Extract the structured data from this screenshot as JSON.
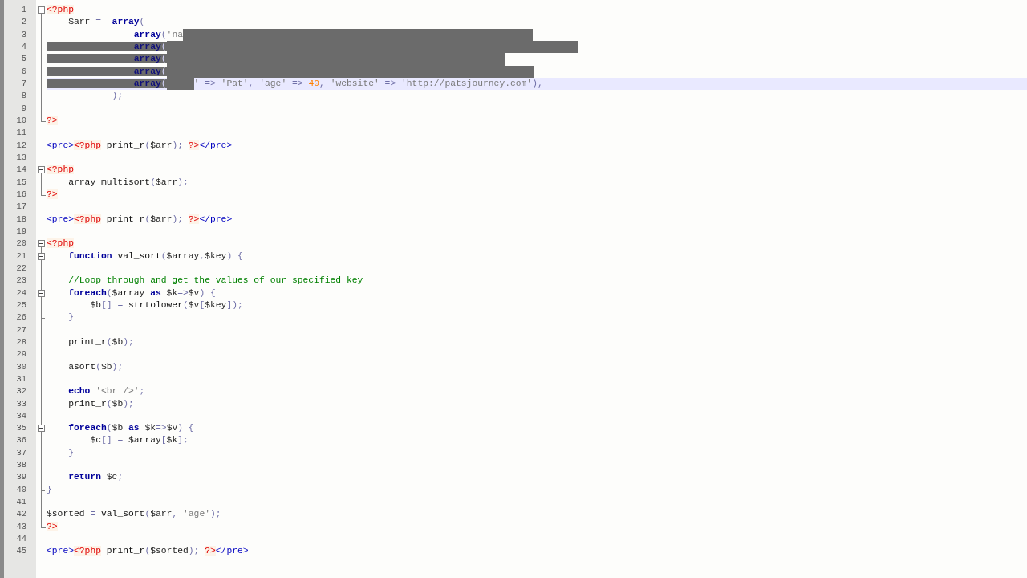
{
  "editor": {
    "lines": [
      {
        "number": "1",
        "kind": "open",
        "current": false,
        "tokens": [
          {
            "kind": "php",
            "text": "<?php"
          }
        ]
      },
      {
        "number": "2",
        "kind": "line",
        "current": false,
        "tokens": [
          {
            "kind": "var",
            "text": "    $arr"
          },
          {
            "kind": "op",
            "text": " =  "
          },
          {
            "kind": "kw",
            "text": "array"
          },
          {
            "kind": "op",
            "text": "("
          }
        ]
      },
      {
        "number": "3",
        "kind": "line",
        "current": false,
        "tokens": [
          {
            "kind": "kw",
            "text": "                array"
          },
          {
            "kind": "op",
            "text": "("
          },
          {
            "kind": "str",
            "text": "'na"
          },
          {
            "kind": "obscured",
            "selected": true
          }
        ]
      },
      {
        "number": "4",
        "kind": "line",
        "current": false,
        "tokens": [
          {
            "kind": "kw",
            "text": "                array",
            "selected": true
          },
          {
            "kind": "op",
            "text": "(",
            "selected": true
          },
          {
            "kind": "obscured",
            "selected": true
          }
        ]
      },
      {
        "number": "5",
        "kind": "line",
        "current": false,
        "tokens": [
          {
            "kind": "kw",
            "text": "                array",
            "selected": true
          },
          {
            "kind": "op",
            "text": "(",
            "selected": true
          },
          {
            "kind": "obscured",
            "selected": true
          }
        ]
      },
      {
        "number": "6",
        "kind": "line",
        "current": false,
        "tokens": [
          {
            "kind": "kw",
            "text": "                array",
            "selected": true
          },
          {
            "kind": "op",
            "text": "(",
            "selected": true
          },
          {
            "kind": "obscured",
            "selected": true
          }
        ]
      },
      {
        "number": "7",
        "kind": "line",
        "current": true,
        "tokens": [
          {
            "kind": "kw",
            "text": "                array",
            "selected": true
          },
          {
            "kind": "op",
            "text": "(",
            "selected": true
          },
          {
            "kind": "obscured",
            "selected": true
          },
          {
            "kind": "str",
            "text": "'"
          },
          {
            "kind": "op",
            "text": " => "
          },
          {
            "kind": "str",
            "text": "'Pat'"
          },
          {
            "kind": "op",
            "text": ", "
          },
          {
            "kind": "str",
            "text": "'age'"
          },
          {
            "kind": "op",
            "text": " => "
          },
          {
            "kind": "num",
            "text": "40"
          },
          {
            "kind": "op",
            "text": ", "
          },
          {
            "kind": "str",
            "text": "'website'"
          },
          {
            "kind": "op",
            "text": " => "
          },
          {
            "kind": "str",
            "text": "'http://patsjourney.com'"
          },
          {
            "kind": "op",
            "text": "),"
          }
        ]
      },
      {
        "number": "8",
        "kind": "line",
        "current": false,
        "tokens": [
          {
            "kind": "op",
            "text": "            );"
          }
        ]
      },
      {
        "number": "9",
        "kind": "line",
        "current": false
      },
      {
        "number": "10",
        "kind": "end",
        "current": false,
        "tokens": [
          {
            "kind": "php",
            "text": "?>"
          }
        ]
      },
      {
        "number": "11",
        "kind": "plain",
        "current": false
      },
      {
        "number": "12",
        "kind": "plain",
        "current": false,
        "tokens": [
          {
            "kind": "tag",
            "text": "<pre>"
          },
          {
            "kind": "php",
            "text": "<?php"
          },
          {
            "kind": "plain",
            "text": " print_r"
          },
          {
            "kind": "op",
            "text": "("
          },
          {
            "kind": "var",
            "text": "$arr"
          },
          {
            "kind": "op",
            "text": "); "
          },
          {
            "kind": "php",
            "text": "?>"
          },
          {
            "kind": "tag",
            "text": "</pre>"
          }
        ]
      },
      {
        "number": "13",
        "kind": "plain",
        "current": false
      },
      {
        "number": "14",
        "kind": "open",
        "current": false,
        "tokens": [
          {
            "kind": "php",
            "text": "<?php"
          }
        ]
      },
      {
        "number": "15",
        "kind": "line",
        "current": false,
        "tokens": [
          {
            "kind": "plain",
            "text": "    array_multisort"
          },
          {
            "kind": "op",
            "text": "("
          },
          {
            "kind": "var",
            "text": "$arr"
          },
          {
            "kind": "op",
            "text": ");"
          }
        ]
      },
      {
        "number": "16",
        "kind": "end",
        "current": false,
        "tokens": [
          {
            "kind": "php",
            "text": "?>"
          }
        ]
      },
      {
        "number": "17",
        "kind": "plain",
        "current": false
      },
      {
        "number": "18",
        "kind": "plain",
        "current": false,
        "tokens": [
          {
            "kind": "tag",
            "text": "<pre>"
          },
          {
            "kind": "php",
            "text": "<?php"
          },
          {
            "kind": "plain",
            "text": " print_r"
          },
          {
            "kind": "op",
            "text": "("
          },
          {
            "kind": "var",
            "text": "$arr"
          },
          {
            "kind": "op",
            "text": "); "
          },
          {
            "kind": "php",
            "text": "?>"
          },
          {
            "kind": "tag",
            "text": "</pre>"
          }
        ]
      },
      {
        "number": "19",
        "kind": "plain",
        "current": false
      },
      {
        "number": "20",
        "kind": "open",
        "current": false,
        "tokens": [
          {
            "kind": "php",
            "text": "<?php"
          }
        ]
      },
      {
        "number": "21",
        "kind": "open",
        "current": false,
        "tokens": [
          {
            "kind": "kw",
            "text": "    function"
          },
          {
            "kind": "plain",
            "text": " val_sort"
          },
          {
            "kind": "op",
            "text": "("
          },
          {
            "kind": "var",
            "text": "$array"
          },
          {
            "kind": "op",
            "text": ","
          },
          {
            "kind": "var",
            "text": "$key"
          },
          {
            "kind": "op",
            "text": ") {"
          }
        ]
      },
      {
        "number": "22",
        "kind": "line",
        "current": false
      },
      {
        "number": "23",
        "kind": "line",
        "current": false,
        "tokens": [
          {
            "kind": "cmt",
            "text": "    //Loop through and get the values of our specified key"
          }
        ]
      },
      {
        "number": "24",
        "kind": "open",
        "current": false,
        "tokens": [
          {
            "kind": "kw",
            "text": "    foreach"
          },
          {
            "kind": "op",
            "text": "("
          },
          {
            "kind": "var",
            "text": "$array "
          },
          {
            "kind": "kw",
            "text": "as"
          },
          {
            "kind": "var",
            "text": " $k"
          },
          {
            "kind": "op",
            "text": "=>"
          },
          {
            "kind": "var",
            "text": "$v"
          },
          {
            "kind": "op",
            "text": ") {"
          }
        ]
      },
      {
        "number": "25",
        "kind": "line",
        "current": false,
        "tokens": [
          {
            "kind": "var",
            "text": "        $b"
          },
          {
            "kind": "op",
            "text": "[] = "
          },
          {
            "kind": "plain",
            "text": "strtolower"
          },
          {
            "kind": "op",
            "text": "("
          },
          {
            "kind": "var",
            "text": "$v"
          },
          {
            "kind": "op",
            "text": "["
          },
          {
            "kind": "var",
            "text": "$key"
          },
          {
            "kind": "op",
            "text": "]);"
          }
        ]
      },
      {
        "number": "26",
        "kind": "mid",
        "current": false,
        "tokens": [
          {
            "kind": "op",
            "text": "    }"
          }
        ]
      },
      {
        "number": "27",
        "kind": "line",
        "current": false
      },
      {
        "number": "28",
        "kind": "line",
        "current": false,
        "tokens": [
          {
            "kind": "plain",
            "text": "    print_r"
          },
          {
            "kind": "op",
            "text": "("
          },
          {
            "kind": "var",
            "text": "$b"
          },
          {
            "kind": "op",
            "text": ");"
          }
        ]
      },
      {
        "number": "29",
        "kind": "line",
        "current": false
      },
      {
        "number": "30",
        "kind": "line",
        "current": false,
        "tokens": [
          {
            "kind": "plain",
            "text": "    asort"
          },
          {
            "kind": "op",
            "text": "("
          },
          {
            "kind": "var",
            "text": "$b"
          },
          {
            "kind": "op",
            "text": ");"
          }
        ]
      },
      {
        "number": "31",
        "kind": "line",
        "current": false
      },
      {
        "number": "32",
        "kind": "line",
        "current": false,
        "tokens": [
          {
            "kind": "kw",
            "text": "    echo"
          },
          {
            "kind": "str",
            "text": " '<br />'"
          },
          {
            "kind": "op",
            "text": ";"
          }
        ]
      },
      {
        "number": "33",
        "kind": "line",
        "current": false,
        "tokens": [
          {
            "kind": "plain",
            "text": "    print_r"
          },
          {
            "kind": "op",
            "text": "("
          },
          {
            "kind": "var",
            "text": "$b"
          },
          {
            "kind": "op",
            "text": ");"
          }
        ]
      },
      {
        "number": "34",
        "kind": "line",
        "current": false
      },
      {
        "number": "35",
        "kind": "open",
        "current": false,
        "tokens": [
          {
            "kind": "kw",
            "text": "    foreach"
          },
          {
            "kind": "op",
            "text": "("
          },
          {
            "kind": "var",
            "text": "$b "
          },
          {
            "kind": "kw",
            "text": "as"
          },
          {
            "kind": "var",
            "text": " $k"
          },
          {
            "kind": "op",
            "text": "=>"
          },
          {
            "kind": "var",
            "text": "$v"
          },
          {
            "kind": "op",
            "text": ") {"
          }
        ]
      },
      {
        "number": "36",
        "kind": "line",
        "current": false,
        "tokens": [
          {
            "kind": "var",
            "text": "        $c"
          },
          {
            "kind": "op",
            "text": "[] = "
          },
          {
            "kind": "var",
            "text": "$array"
          },
          {
            "kind": "op",
            "text": "["
          },
          {
            "kind": "var",
            "text": "$k"
          },
          {
            "kind": "op",
            "text": "];"
          }
        ]
      },
      {
        "number": "37",
        "kind": "mid",
        "current": false,
        "tokens": [
          {
            "kind": "op",
            "text": "    }"
          }
        ]
      },
      {
        "number": "38",
        "kind": "line",
        "current": false
      },
      {
        "number": "39",
        "kind": "line",
        "current": false,
        "tokens": [
          {
            "kind": "kw",
            "text": "    return"
          },
          {
            "kind": "var",
            "text": " $c"
          },
          {
            "kind": "op",
            "text": ";"
          }
        ]
      },
      {
        "number": "40",
        "kind": "mid",
        "current": false,
        "tokens": [
          {
            "kind": "op",
            "text": "}"
          }
        ]
      },
      {
        "number": "41",
        "kind": "line",
        "current": false
      },
      {
        "number": "42",
        "kind": "line",
        "current": false,
        "tokens": [
          {
            "kind": "var",
            "text": "$sorted"
          },
          {
            "kind": "op",
            "text": " = "
          },
          {
            "kind": "plain",
            "text": "val_sort"
          },
          {
            "kind": "op",
            "text": "("
          },
          {
            "kind": "var",
            "text": "$arr"
          },
          {
            "kind": "op",
            "text": ", "
          },
          {
            "kind": "str",
            "text": "'age'"
          },
          {
            "kind": "op",
            "text": ");"
          }
        ]
      },
      {
        "number": "43",
        "kind": "end",
        "current": false,
        "tokens": [
          {
            "kind": "php",
            "text": "?>"
          }
        ]
      },
      {
        "number": "44",
        "kind": "plain",
        "current": false
      },
      {
        "number": "45",
        "kind": "plain",
        "current": false,
        "tokens": [
          {
            "kind": "tag",
            "text": "<pre>"
          },
          {
            "kind": "php",
            "text": "<?php"
          },
          {
            "kind": "plain",
            "text": " print_r"
          },
          {
            "kind": "op",
            "text": "("
          },
          {
            "kind": "var",
            "text": "$sorted"
          },
          {
            "kind": "op",
            "text": "); "
          },
          {
            "kind": "php",
            "text": "?>"
          },
          {
            "kind": "tag",
            "text": "</pre>"
          }
        ]
      }
    ]
  }
}
